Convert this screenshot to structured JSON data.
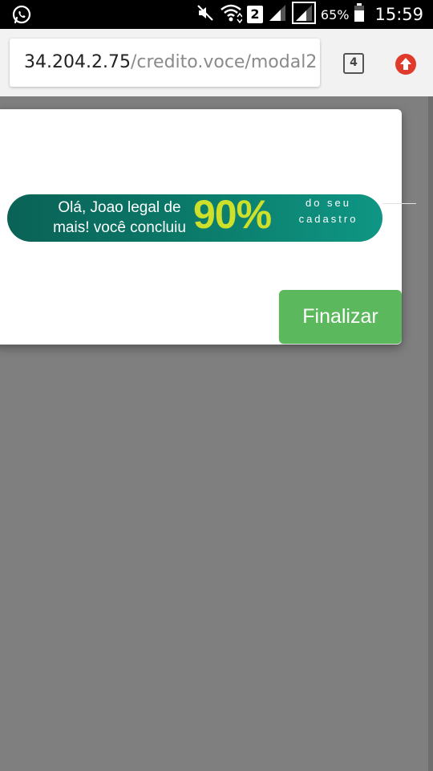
{
  "status_bar": {
    "battery_percent": "65%",
    "time": "15:59",
    "sim_slot": "2",
    "icons": [
      "whatsapp-icon",
      "mute-icon",
      "wifi-icon",
      "signal-icon",
      "signal-icon",
      "battery-icon"
    ]
  },
  "browser": {
    "url_host": "34.204.2.75",
    "url_path": "/credito.voce/modal2",
    "tab_count": "4",
    "update_icon": "arrow-up-icon",
    "colors": {
      "update": "#e03a2d"
    }
  },
  "modal": {
    "progress_pill": {
      "greeting": "Olá, Joao legal de mais! você concluiu",
      "percent": "90%",
      "suffix": "do seu cadastro",
      "colors": {
        "gradient_start": "#0a6256",
        "gradient_end": "#0f9684",
        "percent": "#cfe02a"
      }
    },
    "finalize_label": "Finalizar",
    "colors": {
      "finalize": "#5cb85c"
    }
  },
  "page": {
    "colors": {
      "overlay": "#7f7f7f"
    }
  }
}
